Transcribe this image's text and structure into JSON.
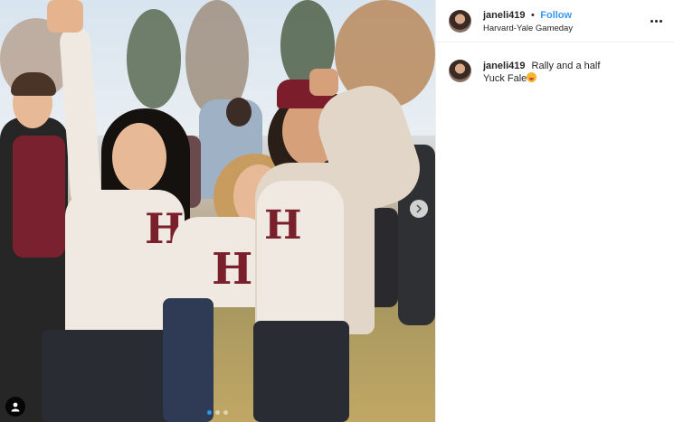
{
  "post": {
    "username": "janeli419",
    "separator": "•",
    "follow_label": "Follow",
    "location": "Harvard-Yale Gameday",
    "caption": {
      "username": "janeli419",
      "line1": "Rally and a half",
      "line2": "Yuck Fale"
    },
    "carousel": {
      "dots_total": 3,
      "active_dot": 1
    },
    "icons": {
      "more": "more-options-icon",
      "next": "chevron-right-icon",
      "tag": "user-tag-icon",
      "emoji": "face-with-tongue-emoji"
    },
    "colors": {
      "link": "#3897f0",
      "text": "#262626",
      "active_dot": "#2d95f0"
    }
  }
}
